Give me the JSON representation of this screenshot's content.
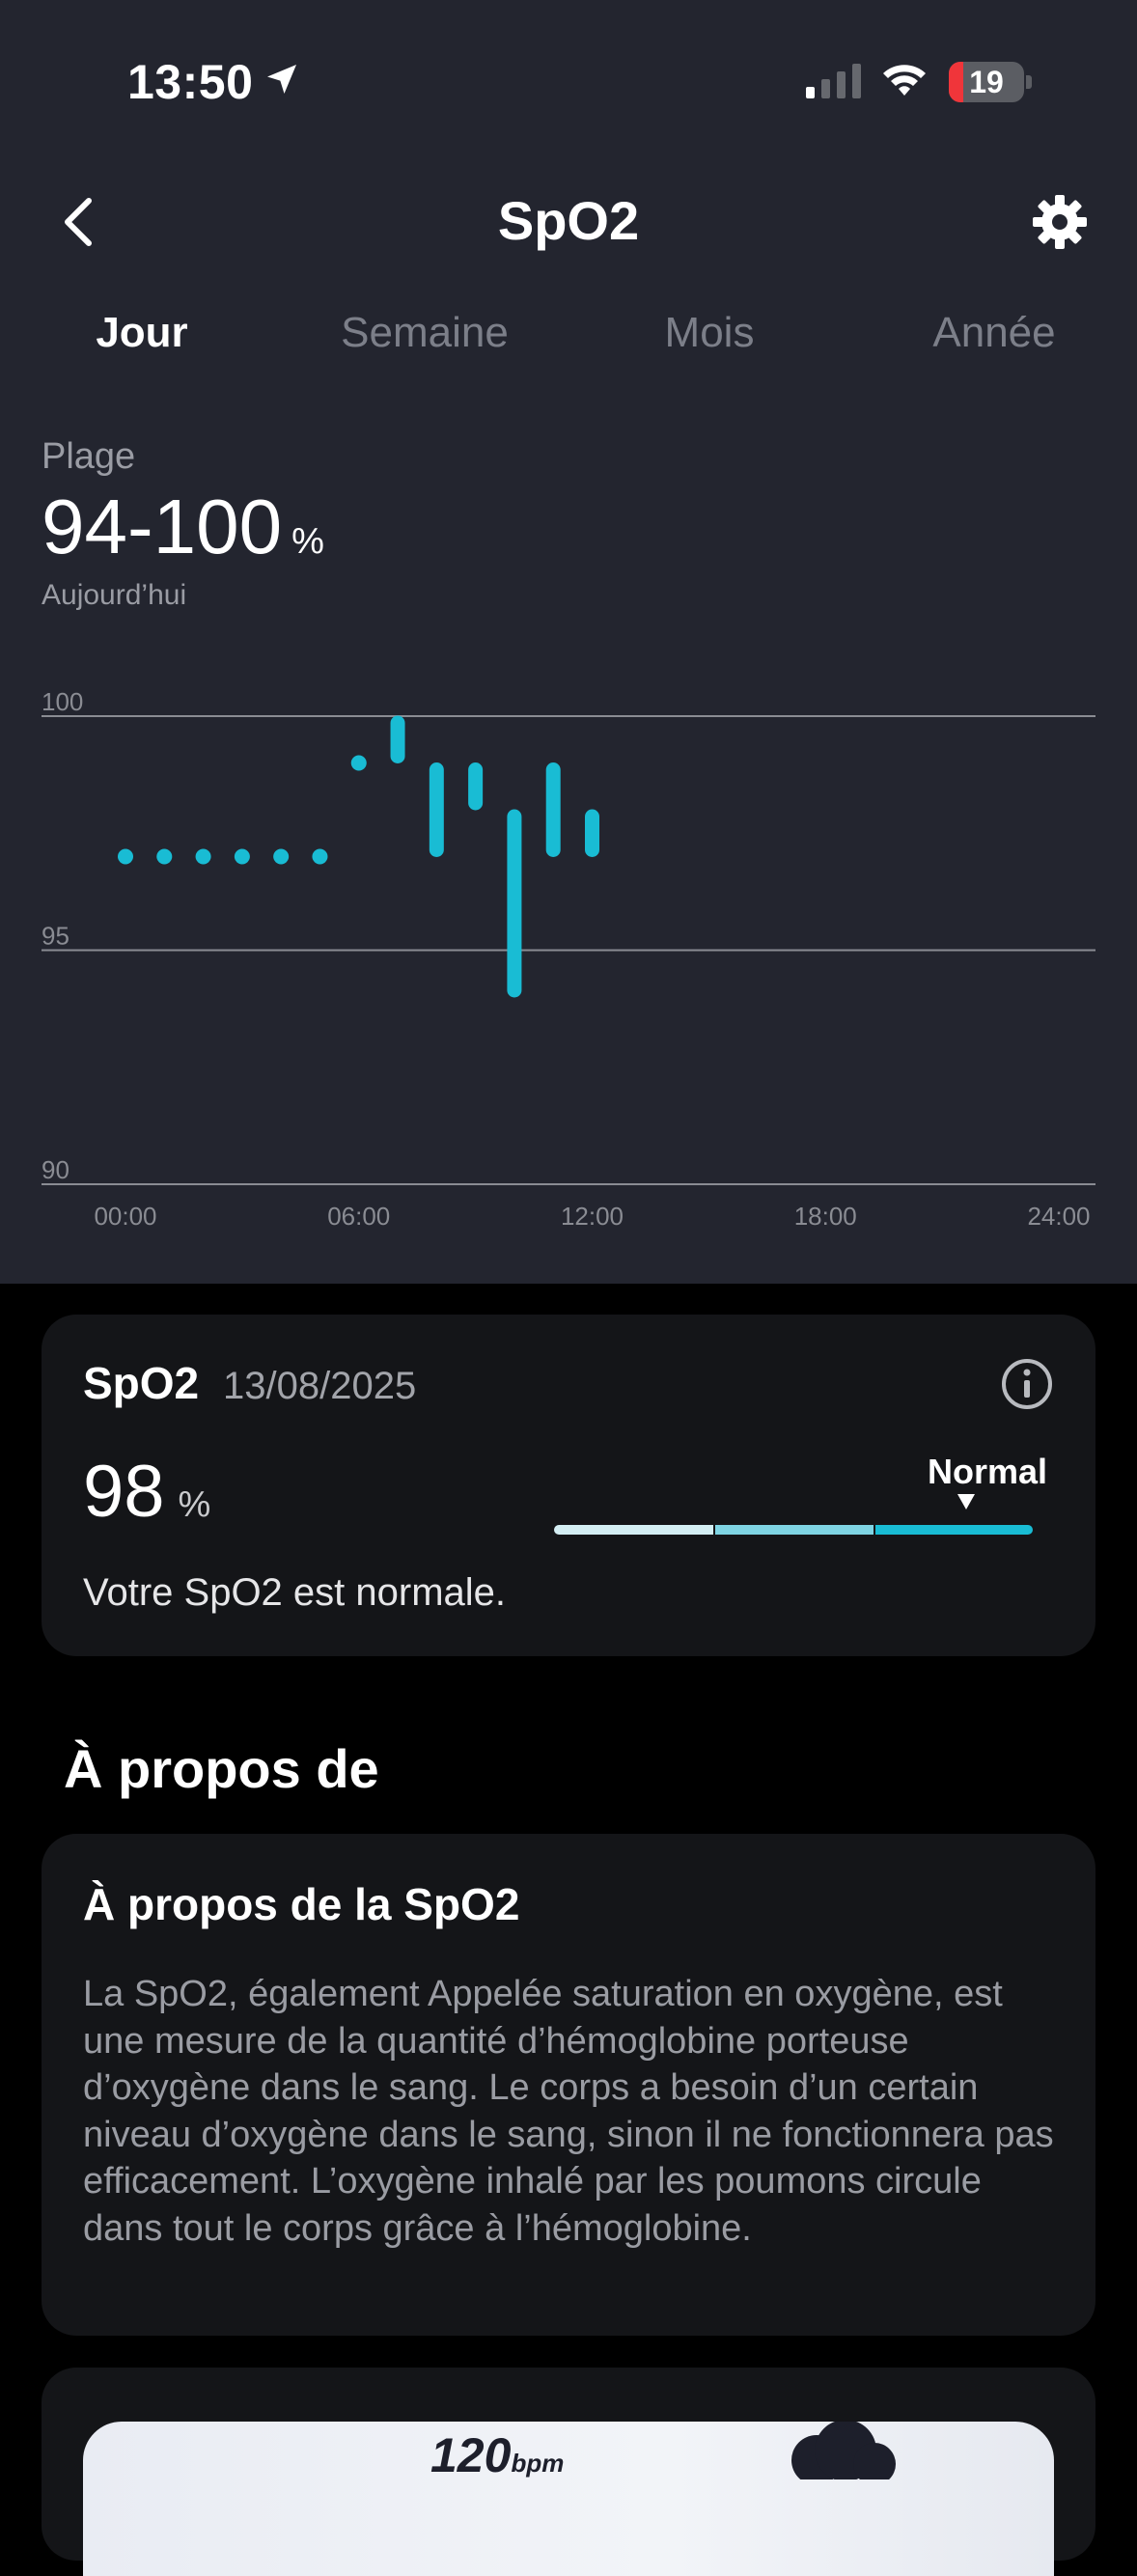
{
  "status_bar": {
    "time": "13:50",
    "battery": "19",
    "battery_level": 0.19
  },
  "header": {
    "title": "SpO2"
  },
  "tabs": [
    "Jour",
    "Semaine",
    "Mois",
    "Année"
  ],
  "active_tab": 0,
  "summary": {
    "label": "Plage",
    "value": "94-100",
    "unit": "%",
    "date": "Aujourd’hui"
  },
  "chart_data": {
    "type": "range",
    "x_ticks": [
      "00:00",
      "06:00",
      "12:00",
      "18:00",
      "24:00"
    ],
    "y_ticks": [
      "100",
      "95",
      "90"
    ],
    "ylim": [
      90,
      100
    ],
    "xlim": [
      0,
      24
    ],
    "grid": true,
    "color": "#19bcd4",
    "points": [
      {
        "x": 0,
        "min": 97,
        "max": 97
      },
      {
        "x": 1,
        "min": 97,
        "max": 97
      },
      {
        "x": 2,
        "min": 97,
        "max": 97
      },
      {
        "x": 3,
        "min": 97,
        "max": 97
      },
      {
        "x": 4,
        "min": 97,
        "max": 97
      },
      {
        "x": 5,
        "min": 97,
        "max": 97
      },
      {
        "x": 6,
        "min": 99,
        "max": 99
      },
      {
        "x": 7,
        "min": 99,
        "max": 100
      },
      {
        "x": 8,
        "min": 97,
        "max": 99
      },
      {
        "x": 9,
        "min": 98,
        "max": 99
      },
      {
        "x": 10,
        "min": 94,
        "max": 98
      },
      {
        "x": 11,
        "min": 97,
        "max": 99
      },
      {
        "x": 12,
        "min": 97,
        "max": 98
      }
    ]
  },
  "latest_card": {
    "title": "SpO2",
    "date": "13/08/2025",
    "value": "98",
    "unit": "%",
    "status_label": "Normal",
    "message": "Votre SpO2 est normale.",
    "scale_colors": [
      "#d4eef3",
      "#7fd4e3",
      "#19bcd4"
    ]
  },
  "about": {
    "section_title": "À propos de",
    "card_title": "À propos de la SpO2",
    "body": "La SpO2, également Appelée saturation en oxygène, est une mesure de la quantité d’hémoglobine porteuse d’oxygène dans le sang. Le corps a besoin d’un certain niveau d’oxygène dans le sang, sinon il ne fonctionnera pas efficacement. L’oxygène inhalé par les poumons circule dans tout le corps grâce à l’hémoglobine."
  },
  "promo": {
    "number": "120",
    "unit": "bpm"
  },
  "icons": {
    "location": "location-arrow-icon",
    "signal": "cellular-signal-icon",
    "wifi": "wifi-icon",
    "back": "chevron-left-icon",
    "settings": "gear-icon",
    "info": "info-icon"
  }
}
